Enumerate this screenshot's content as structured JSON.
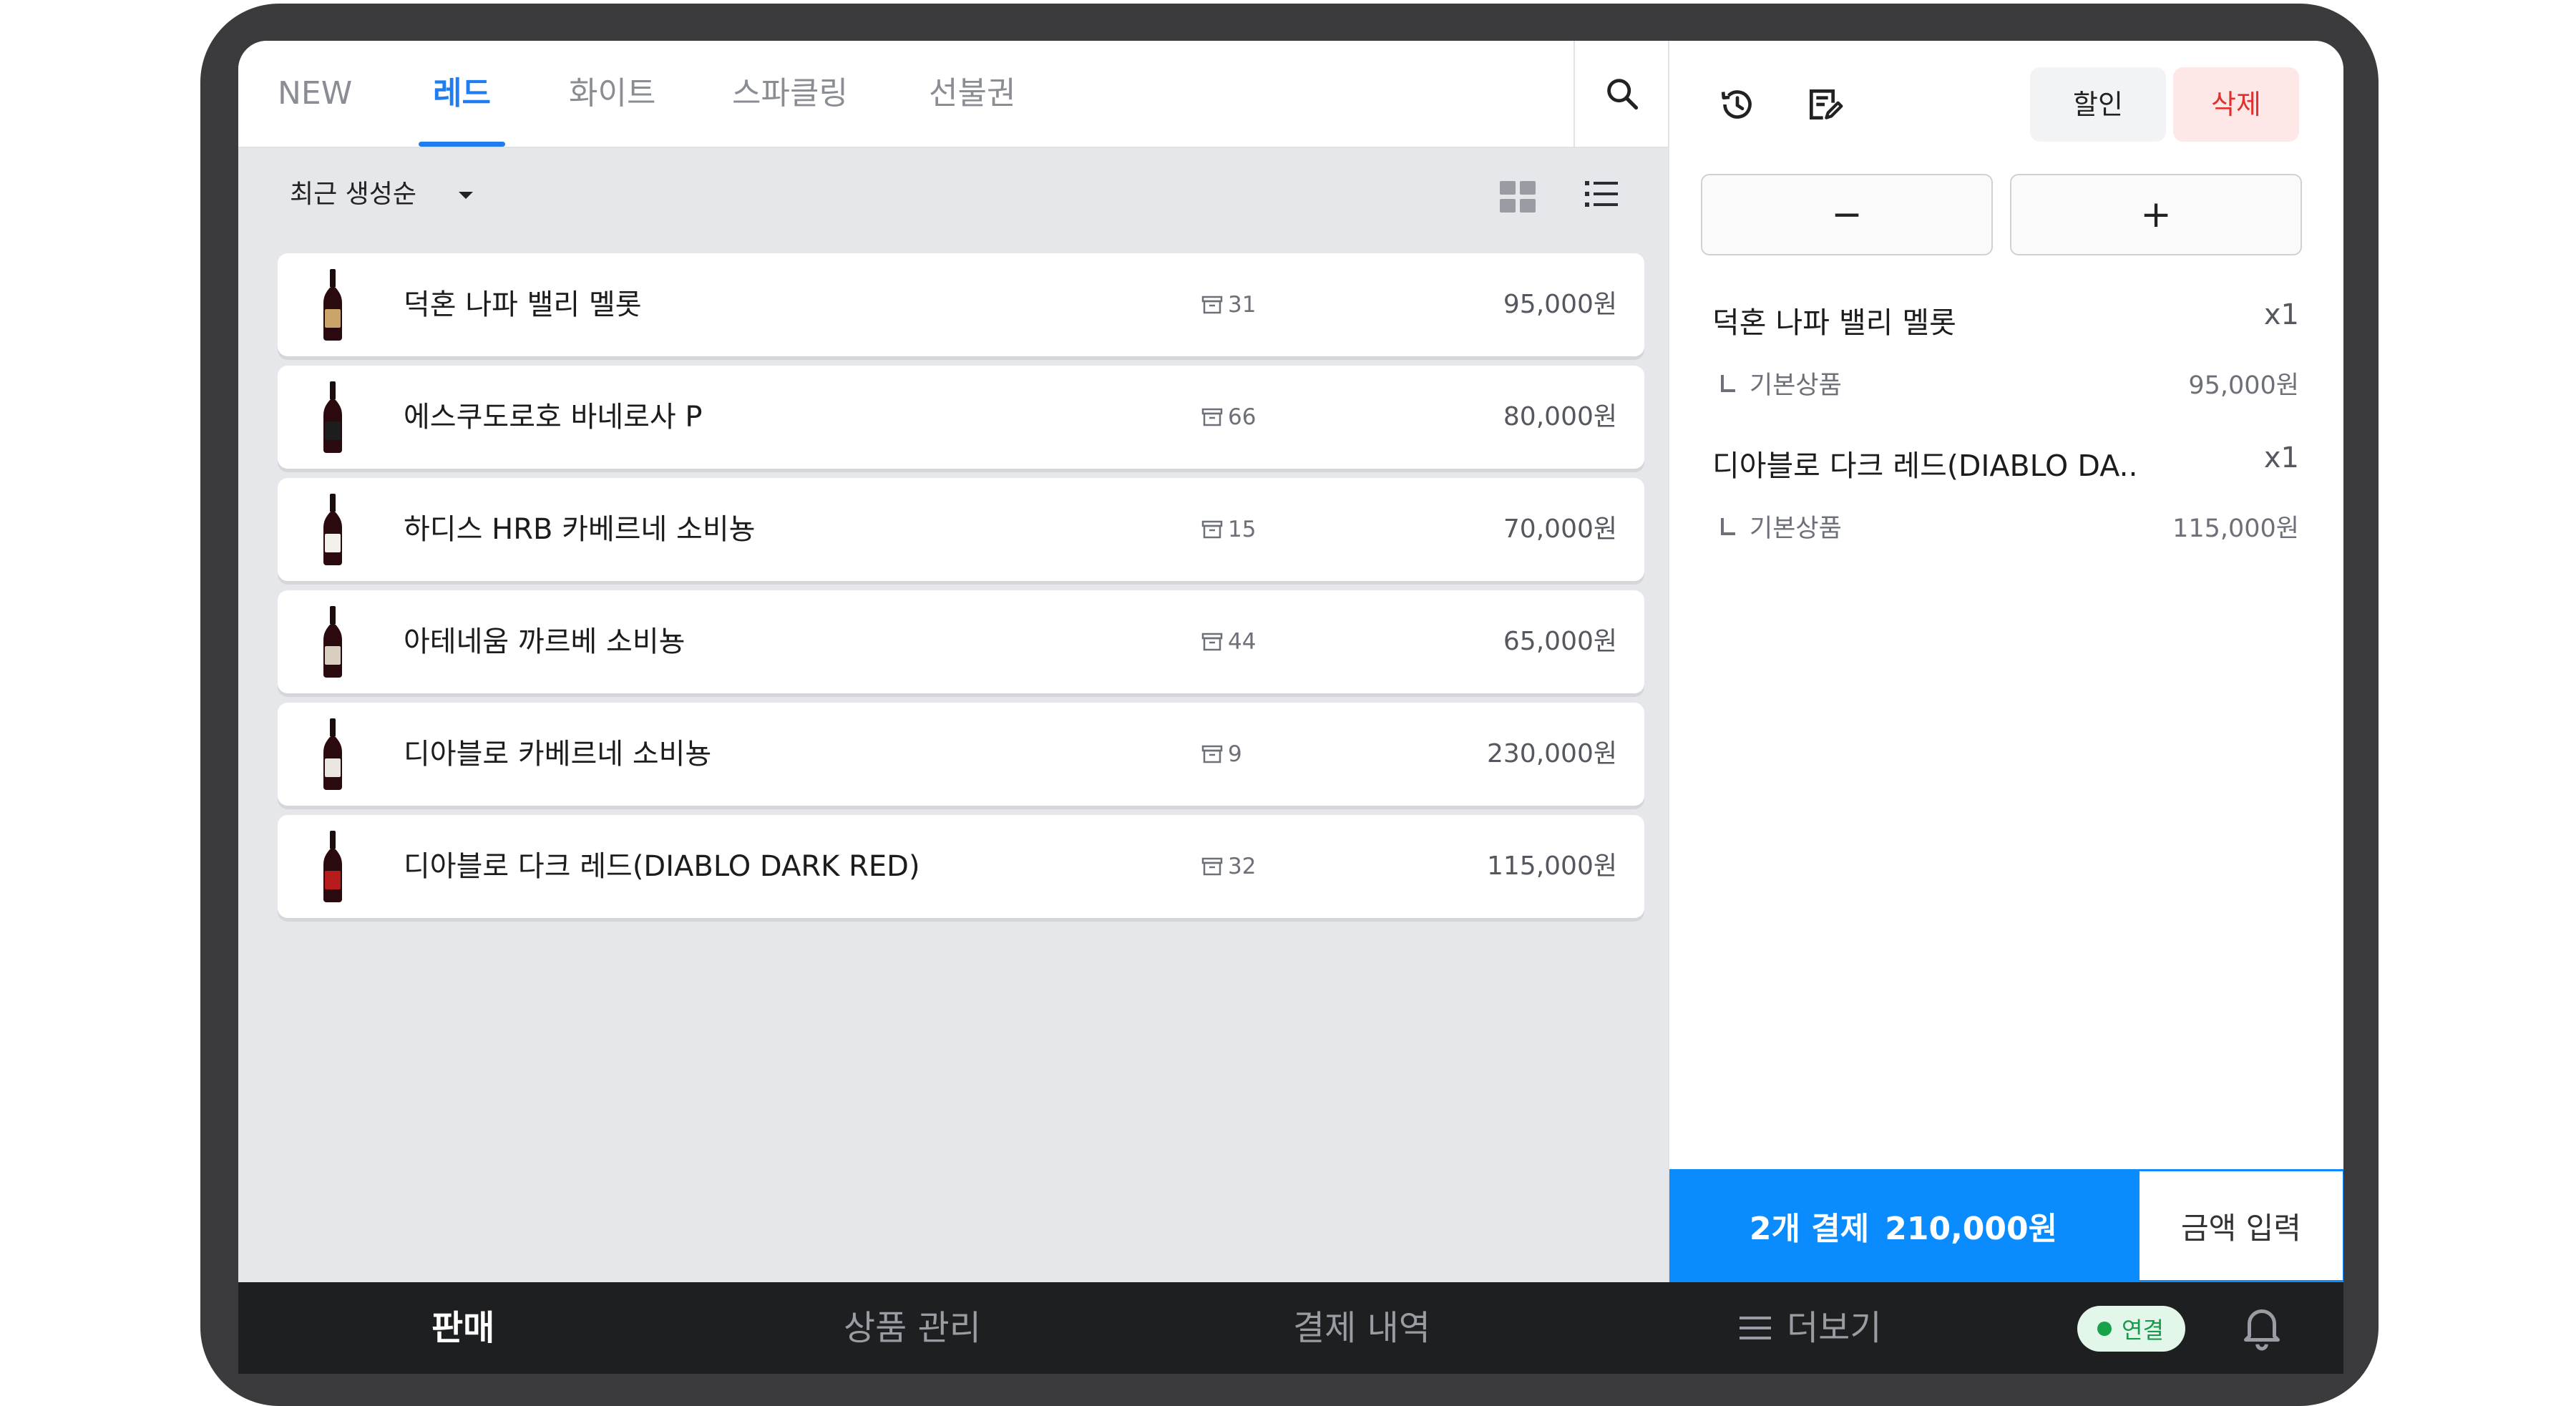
{
  "tabs": [
    {
      "label": "NEW",
      "active": false
    },
    {
      "label": "레드",
      "active": true
    },
    {
      "label": "화이트",
      "active": false
    },
    {
      "label": "스파클링",
      "active": false
    },
    {
      "label": "선불권",
      "active": false
    }
  ],
  "sort": {
    "label": "최근 생성순"
  },
  "icons": {
    "search": "search-icon",
    "grid_view": "grid-view-icon",
    "list_view": "list-view-icon",
    "history": "history-icon",
    "memo": "edit-note-icon",
    "bell": "bell-icon"
  },
  "products": [
    {
      "name": "덕혼 나파 밸리 멜롯",
      "stock": "31",
      "price": "95,000원",
      "label_color": "#caa56a"
    },
    {
      "name": "에스쿠도로호 바네로사 P",
      "stock": "66",
      "price": "80,000원",
      "label_color": "#1d1d1d"
    },
    {
      "name": "하디스 HRB 카베르네 소비뇽",
      "stock": "15",
      "price": "70,000원",
      "label_color": "#f2f0ea"
    },
    {
      "name": "아테네움 까르베 소비뇽",
      "stock": "44",
      "price": "65,000원",
      "label_color": "#d8cfc0"
    },
    {
      "name": "디아블로 카베르네 소비뇽",
      "stock": "9",
      "price": "230,000원",
      "label_color": "#e9e6e2"
    },
    {
      "name": "디아블로 다크 레드(DIABLO DARK RED)",
      "stock": "32",
      "price": "115,000원",
      "label_color": "#b71c1c"
    }
  ],
  "actions": {
    "discount": "할인",
    "delete": "삭제",
    "minus": "−",
    "plus": "+"
  },
  "cart": [
    {
      "name": "덕혼 나파 밸리 멜롯",
      "qty": "x1",
      "option": "기본상품",
      "price": "95,000원"
    },
    {
      "name": "디아블로 다크 레드(DIABLO DA..",
      "qty": "x1",
      "option": "기본상품",
      "price": "115,000원"
    }
  ],
  "pay": {
    "count_label": "2개 결제",
    "total": "210,000원",
    "amount_input": "금액 입력"
  },
  "nav": {
    "sell": "판매",
    "products": "상품 관리",
    "history": "결제 내역",
    "more": "더보기",
    "status": "연결"
  },
  "colors": {
    "accent": "#0a8cff",
    "danger": "#e0312f",
    "connected": "#16a34a"
  }
}
